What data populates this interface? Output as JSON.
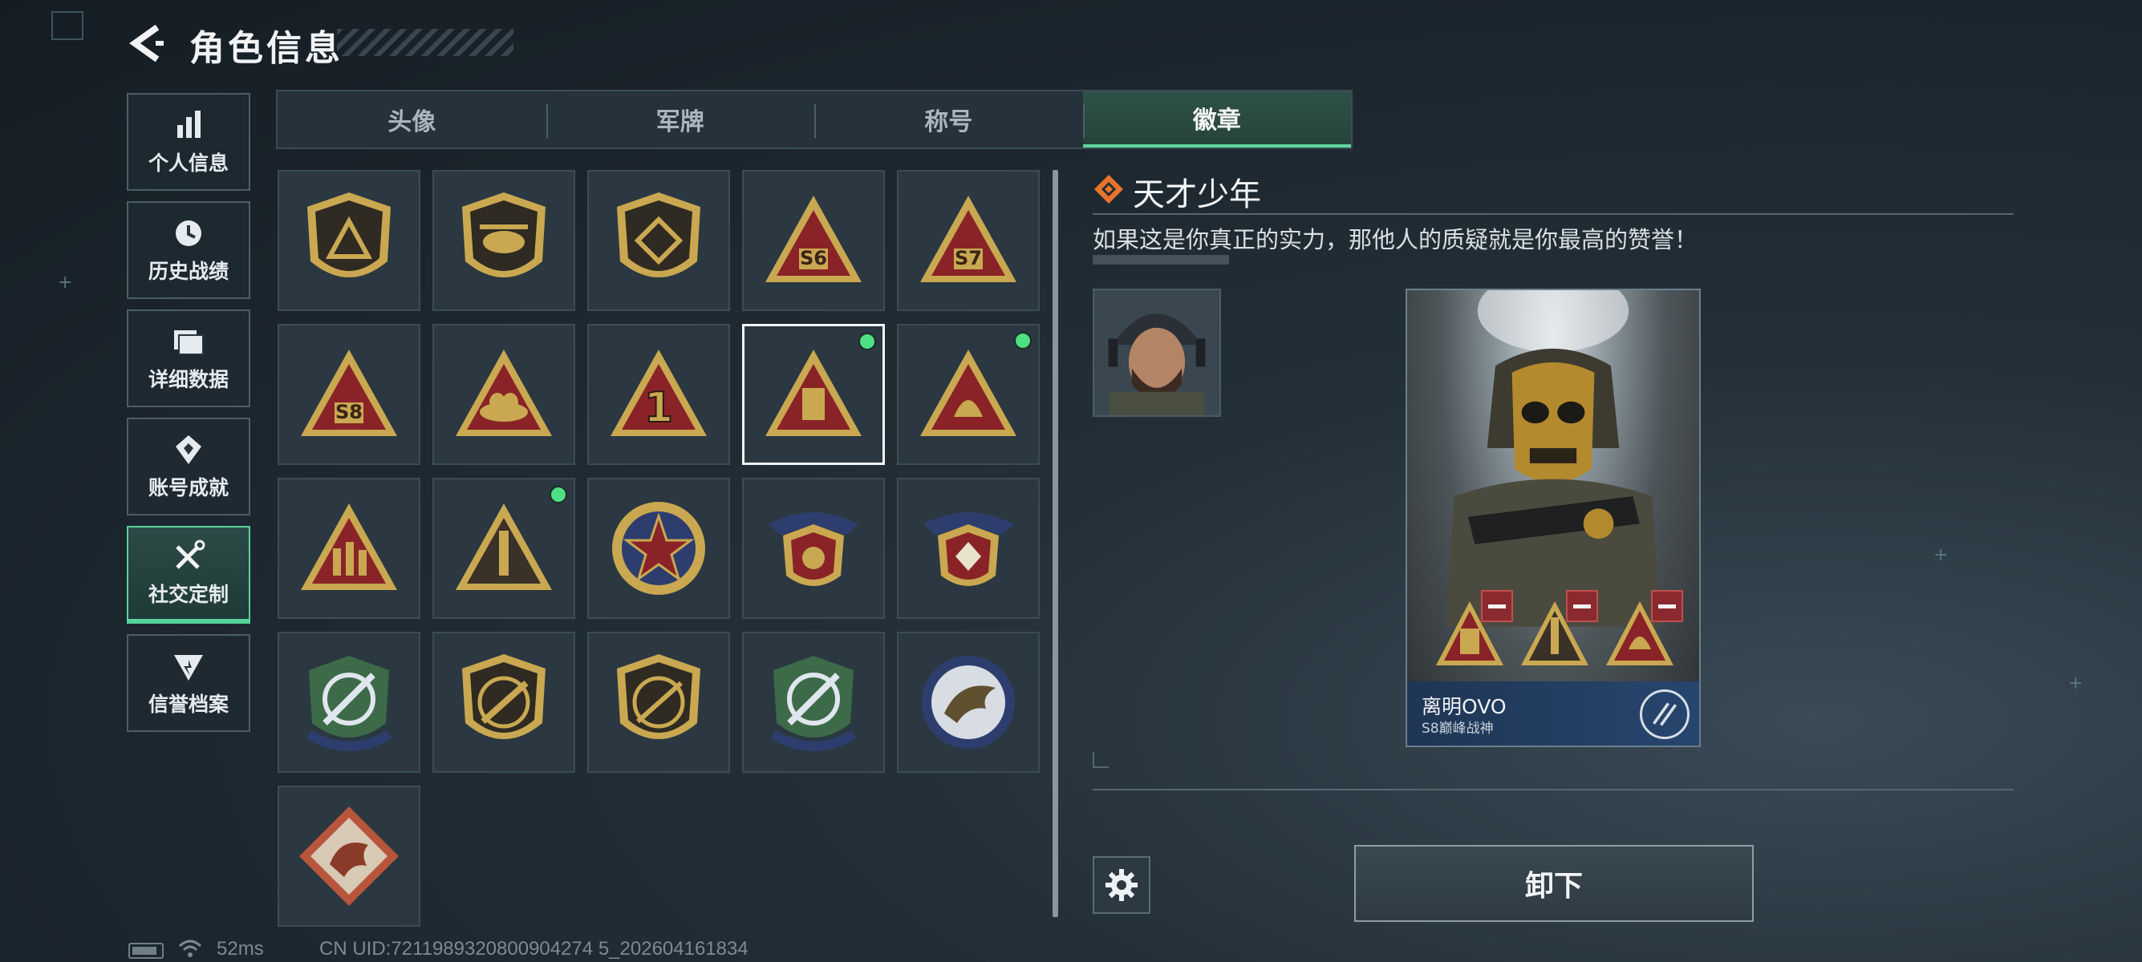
{
  "header": {
    "title": "角色信息"
  },
  "nav": {
    "items": [
      {
        "label": "个人信息",
        "icon": "bar-chart-icon"
      },
      {
        "label": "历史战绩",
        "icon": "history-clock-icon"
      },
      {
        "label": "详细数据",
        "icon": "folder-icon"
      },
      {
        "label": "账号成就",
        "icon": "achievement-icon"
      },
      {
        "label": "社交定制",
        "icon": "tools-icon",
        "active": true
      },
      {
        "label": "信誉档案",
        "icon": "reputation-icon"
      }
    ]
  },
  "tabs": [
    {
      "label": "头像"
    },
    {
      "label": "军牌"
    },
    {
      "label": "称号"
    },
    {
      "label": "徽章",
      "active": true
    }
  ],
  "badges": [
    {
      "icon": "shield-triangle-badge-icon"
    },
    {
      "icon": "helicopter-badge-icon"
    },
    {
      "icon": "shield-diamond-badge-icon"
    },
    {
      "icon": "s6-season-badge-icon",
      "text": "S6"
    },
    {
      "icon": "s7-season-badge-icon",
      "text": "S7"
    },
    {
      "icon": "s8-season-badge-icon",
      "text": "S8"
    },
    {
      "icon": "egg-nest-badge-icon"
    },
    {
      "icon": "rank-one-badge-icon",
      "text": "1"
    },
    {
      "icon": "usb-triangle-badge-icon",
      "selected": true,
      "equipped": true
    },
    {
      "icon": "helmet-triangle-badge-icon",
      "equipped": true
    },
    {
      "icon": "soldiers-triangle-badge-icon"
    },
    {
      "icon": "rocket-triangle-badge-icon",
      "equipped": true
    },
    {
      "icon": "star-emblem-badge-icon"
    },
    {
      "icon": "winged-shield-badge-icon"
    },
    {
      "icon": "winged-shield-gem-badge-icon"
    },
    {
      "icon": "sniper-crest-badge-icon"
    },
    {
      "icon": "rifle-shield-badge-icon"
    },
    {
      "icon": "rifle-shield-dark-badge-icon"
    },
    {
      "icon": "sniper-crest-2-badge-icon"
    },
    {
      "icon": "eagle-badge-icon"
    },
    {
      "icon": "dragon-badge-icon"
    }
  ],
  "detail": {
    "title": "天才少年",
    "description": "如果这是你真正的实力，那他人的质疑就是你最高的赞誉！",
    "card_name": "离明OVO",
    "card_subtitle": "S8巅峰战神"
  },
  "actions": {
    "remove_label": "卸下"
  },
  "status": {
    "ping": "52ms",
    "uid": "CN UID:7211989320800904274 5_202604161834"
  },
  "colors": {
    "accent_green": "#58d29b",
    "equipped_dot": "#4ee084",
    "badge_gold": "#c9a851",
    "badge_red": "#8a2327",
    "card_banner": "#27466f"
  }
}
